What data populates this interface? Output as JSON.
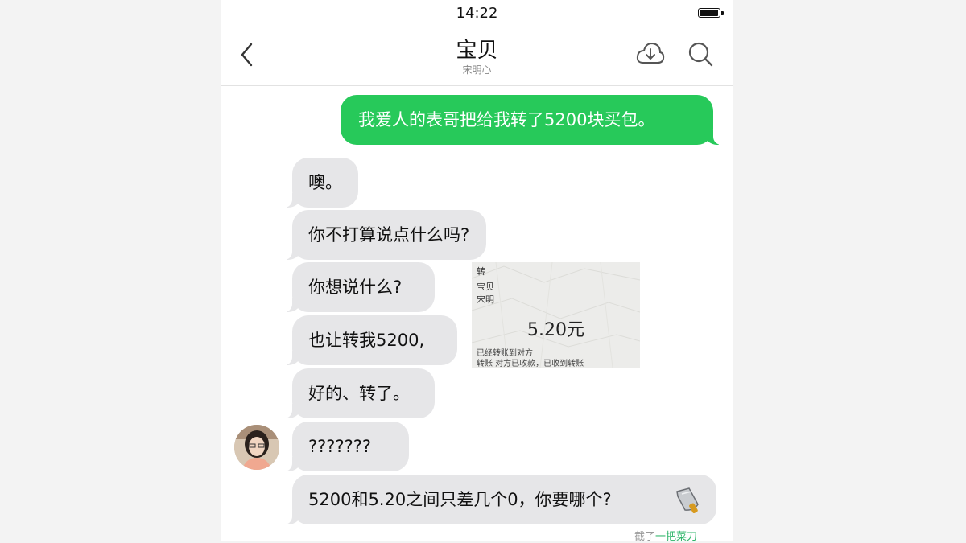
{
  "status_bar": {
    "time": "14:22"
  },
  "nav": {
    "back_icon": "chevron-left-icon",
    "title": "宝贝",
    "subtitle": "宋明心",
    "cloud_icon": "cloud-download-icon",
    "search_icon": "search-icon"
  },
  "messages": [
    {
      "side": "sent",
      "text": "我爱人的表哥把给我转了5200块买包。"
    },
    {
      "side": "received",
      "text": "噢。"
    },
    {
      "side": "received",
      "text": "你不打算说点什么吗?"
    },
    {
      "side": "received",
      "text": "你想说什么?"
    },
    {
      "side": "received",
      "text": "也让转我5200,"
    },
    {
      "side": "received",
      "text": "好的、转了。"
    },
    {
      "side": "received",
      "text": "???????"
    },
    {
      "side": "received",
      "text": "5200和5.20之间只差几个0，你要哪个?",
      "icon": "cleaver-icon"
    }
  ],
  "transfer_receipt": {
    "line1": "转",
    "line2": "宝贝",
    "line3": "宋明",
    "amount": "5.20元",
    "note1": "已经转账到对方",
    "note2": "转账  对方已收款，已收到转账"
  },
  "footer": {
    "caption_prefix": "截了",
    "caption_accent": "一把菜刀"
  },
  "colors": {
    "sent_bubble": "#27c95a",
    "received_bubble": "#e6e6e8",
    "background": "#ffffff"
  }
}
